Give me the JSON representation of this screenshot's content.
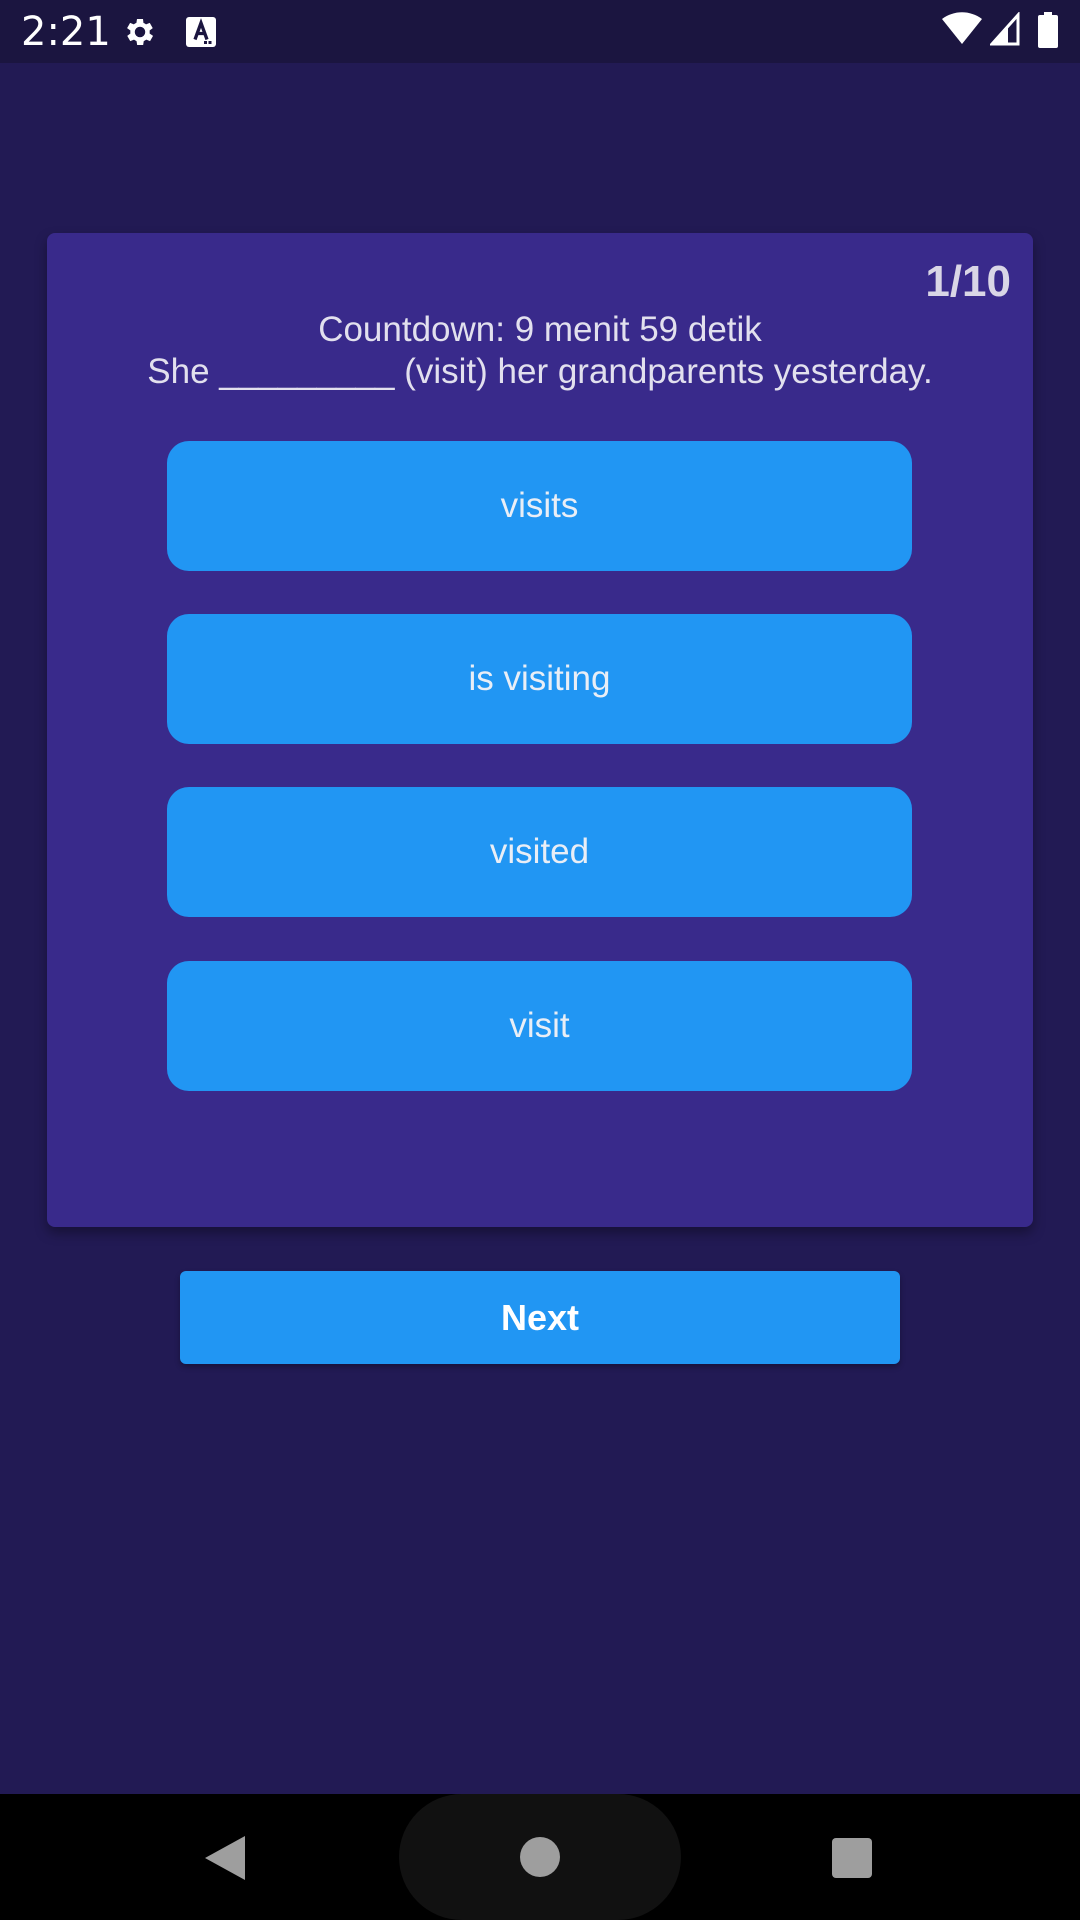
{
  "status_bar": {
    "time": "2:21",
    "icons": [
      "gear-icon",
      "font-app-icon",
      "wifi-icon",
      "signal-icon",
      "battery-icon"
    ]
  },
  "quiz": {
    "progress": "1/10",
    "countdown": "Countdown: 9 menit 59 detik",
    "question": "She _________ (visit) her grandparents yesterday.",
    "options": [
      "visits",
      "is visiting",
      "visited",
      "visit"
    ]
  },
  "next_button_label": "Next",
  "navigation": {
    "icons": [
      "back-icon",
      "home-icon",
      "recents-icon"
    ]
  },
  "colors": {
    "background": "#221a54",
    "card": "#392a8b",
    "accent": "#2196f3",
    "status_bar": "#1b1540"
  }
}
